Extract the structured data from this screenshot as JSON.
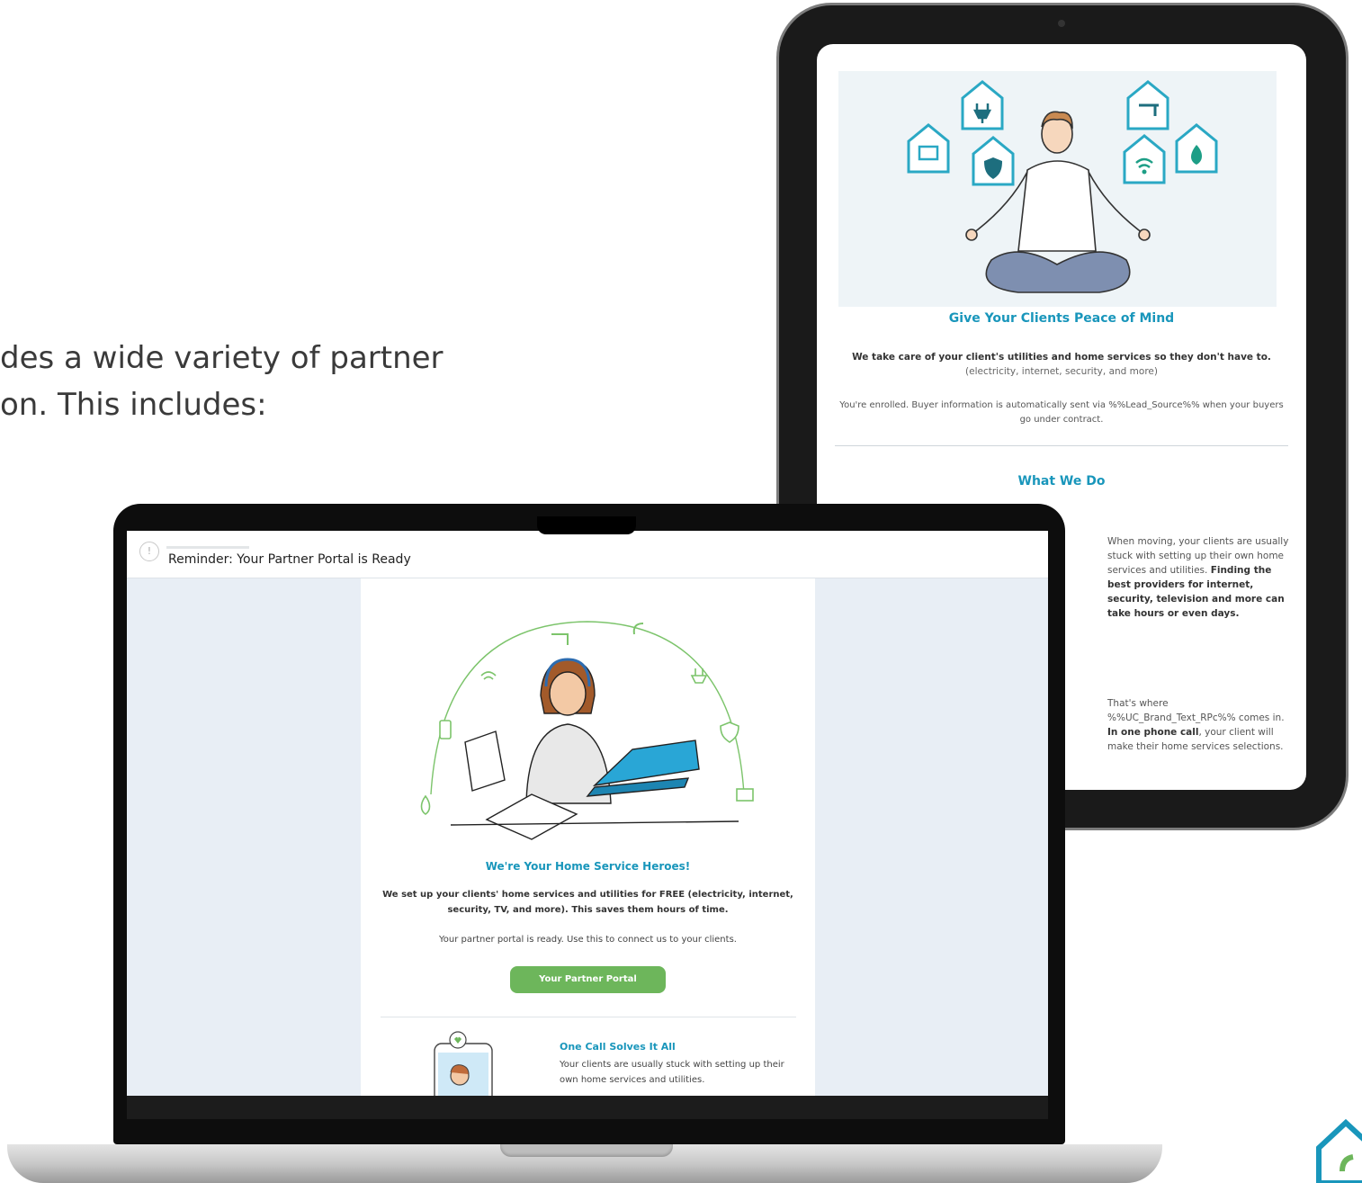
{
  "background_text": {
    "line1": "des a wide variety of partner",
    "line2": "on. This includes:"
  },
  "tablet_email": {
    "title": "Give Your Clients Peace of Mind",
    "intro_bold": "We take care of your client's utilities and home services so they don't have to.",
    "intro_sub": "(electricity, internet, security, and more)",
    "enrolled_text": "You're enrolled.  Buyer information is automatically sent via %%Lead_Source%% when your buyers go under contract.",
    "section_title": "What We Do",
    "para1_plain": "When moving, your clients are usually stuck with setting up their own home services and utilities. ",
    "para1_bold": "Finding the best providers for internet, security, television and more can take hours or even days.",
    "para2_plain_1": "That's where %%UC_Brand_Text_RPc%% comes in. ",
    "para2_bold": "In one phone call",
    "para2_plain_2": ", your client will make their home services selections."
  },
  "laptop_email": {
    "subject": "Reminder: Your Partner Portal is Ready",
    "title": "We're Your Home Service Heroes!",
    "intro": "We set up your clients' home services and utilities for FREE (electricity, internet, security, TV, and more).  This saves them hours of time.",
    "portal_text": "Your partner portal is ready.  Use this to connect us to your clients.",
    "button_label": "Your Partner Portal",
    "call_title": "One Call Solves It All",
    "call_text": "Your clients are usually stuck with setting up their own home services and utilities."
  },
  "colors": {
    "accent_blue": "#1996bb",
    "button_green": "#6db65b",
    "email_background": "#e8eef5"
  },
  "icons": [
    "tv-icon",
    "plug-icon",
    "shield-icon",
    "faucet-icon",
    "wifi-icon",
    "flame-icon",
    "phone-icon",
    "laptop-icon",
    "heart-icon",
    "avatar-icon"
  ]
}
